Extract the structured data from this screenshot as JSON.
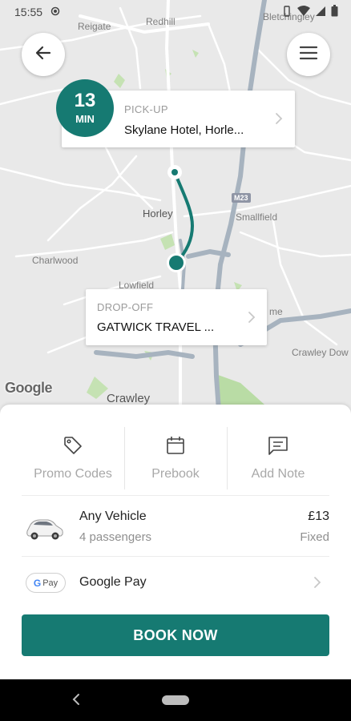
{
  "status_bar": {
    "time": "15:55",
    "icons": [
      "location-icon",
      "vibrate-icon",
      "wifi-icon",
      "signal-icon",
      "battery-icon"
    ]
  },
  "map": {
    "labels": {
      "reigate": "Reigate",
      "redhill": "Redhill",
      "bletchingley": "Bletchingley",
      "horley": "Horley",
      "smallfield": "Smallfield",
      "charlwood": "Charlwood",
      "lowfield": "Lowfield",
      "crawley_down": "Crawley Dow",
      "crawley": "Crawley",
      "me_partial": "me",
      "m23": "M23"
    },
    "attribution": "Google",
    "route_color": "#167a72"
  },
  "header": {
    "back_icon": "arrow-left-icon",
    "menu_icon": "hamburger-menu-icon"
  },
  "pickup": {
    "eta_value": "13",
    "eta_unit": "MIN",
    "label": "PICK-UP",
    "address": "Skylane Hotel, Horle..."
  },
  "dropoff": {
    "label": "DROP-OFF",
    "address": "GATWICK TRAVEL ..."
  },
  "actions": [
    {
      "label": "Promo Codes",
      "icon": "tag-icon"
    },
    {
      "label": "Prebook",
      "icon": "calendar-icon"
    },
    {
      "label": "Add Note",
      "icon": "chat-note-icon"
    }
  ],
  "vehicle": {
    "title": "Any Vehicle",
    "subtitle": "4 passengers",
    "price": "£13",
    "price_type": "Fixed"
  },
  "payment": {
    "badge_g": "G",
    "badge_text": "Pay",
    "method": "Google Pay"
  },
  "book_button": "BOOK NOW",
  "colors": {
    "accent": "#167a72",
    "map_bg": "#e9e9e9",
    "motorway": "#a7b3bf",
    "green_area": "#b9dca5"
  }
}
